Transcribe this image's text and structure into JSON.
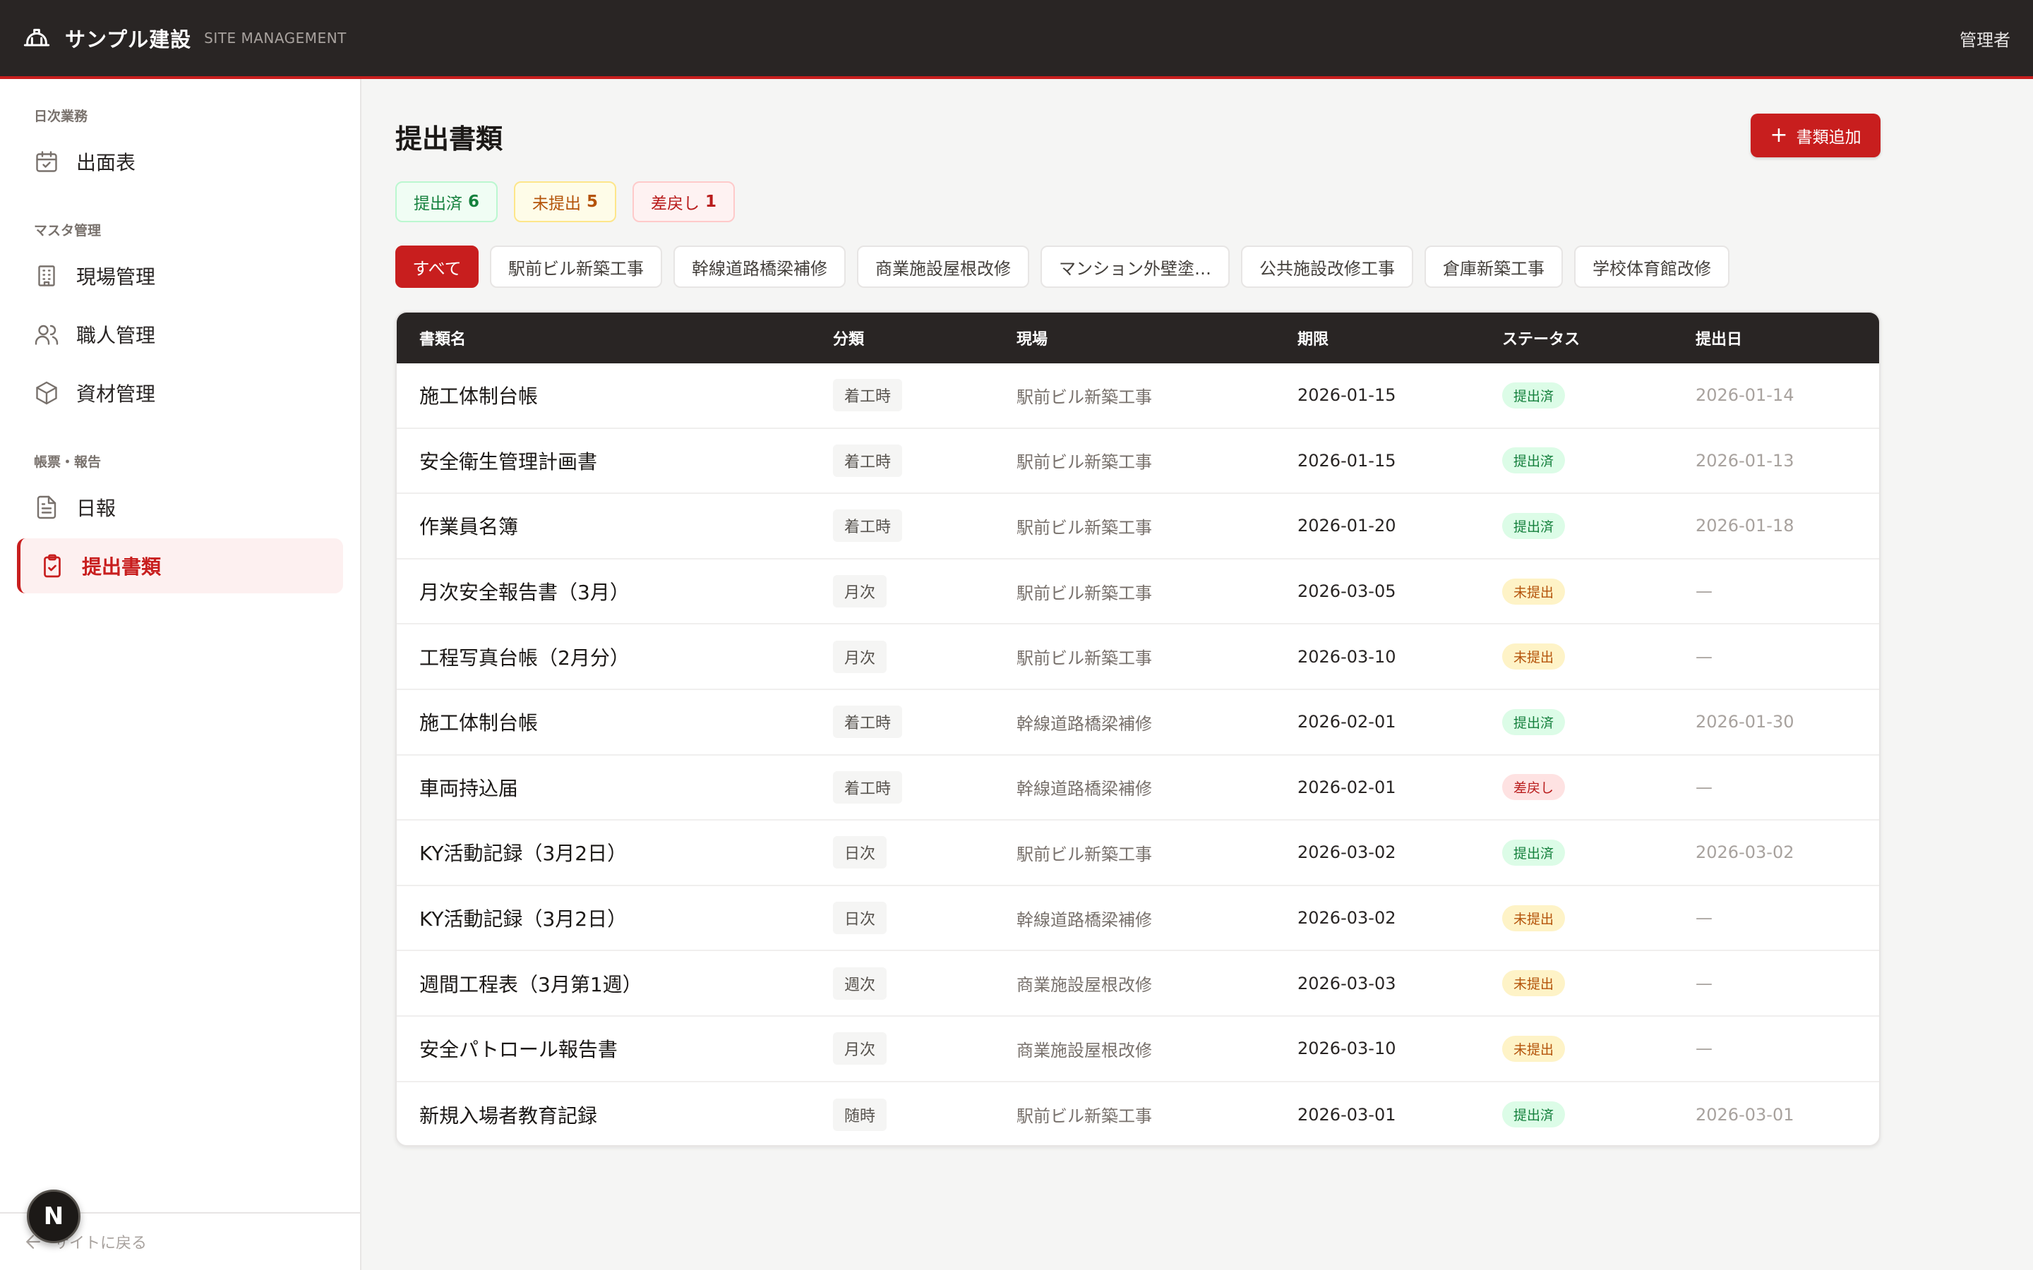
{
  "header": {
    "brand_name": "サンプル建設",
    "brand_sub": "SITE MANAGEMENT",
    "user_label": "管理者",
    "logo_icon": "hard-hat-icon"
  },
  "sidebar": {
    "sections": [
      {
        "label": "日次業務",
        "items": [
          {
            "label": "出面表",
            "icon": "calendar-check-icon"
          }
        ]
      },
      {
        "label": "マスタ管理",
        "items": [
          {
            "label": "現場管理",
            "icon": "building-icon"
          },
          {
            "label": "職人管理",
            "icon": "users-icon"
          },
          {
            "label": "資材管理",
            "icon": "box-icon"
          }
        ]
      },
      {
        "label": "帳票・報告",
        "items": [
          {
            "label": "日報",
            "icon": "document-icon"
          },
          {
            "label": "提出書類",
            "icon": "clipboard-check-icon",
            "active": true
          }
        ]
      }
    ],
    "footer_label": "サイトに戻る",
    "n_badge": "N"
  },
  "main": {
    "title": "提出書類",
    "add_button_label": "書類追加",
    "stats": [
      {
        "label": "提出済",
        "count": "6",
        "color": "#15803d"
      },
      {
        "label": "未提出",
        "count": "5",
        "color": "#b45309"
      },
      {
        "label": "差戻し",
        "count": "1",
        "color": "#b91c1c"
      }
    ],
    "filters": [
      "すべて",
      "駅前ビル新築工事",
      "幹線道路橋梁補修",
      "商業施設屋根改修",
      "マンション外壁塗…",
      "公共施設改修工事",
      "倉庫新築工事",
      "学校体育館改修"
    ],
    "active_filter": "すべて"
  },
  "table": {
    "columns": [
      "書類名",
      "分類",
      "現場",
      "期限",
      "ステータス",
      "提出日"
    ],
    "rows": [
      {
        "name": "施工体制台帳",
        "category": "着工時",
        "site": "駅前ビル新築工事",
        "due": "2026-01-15",
        "status": "提出済",
        "submitted": "2026-01-14"
      },
      {
        "name": "安全衛生管理計画書",
        "category": "着工時",
        "site": "駅前ビル新築工事",
        "due": "2026-01-15",
        "status": "提出済",
        "submitted": "2026-01-13"
      },
      {
        "name": "作業員名簿",
        "category": "着工時",
        "site": "駅前ビル新築工事",
        "due": "2026-01-20",
        "status": "提出済",
        "submitted": "2026-01-18"
      },
      {
        "name": "月次安全報告書（3月）",
        "category": "月次",
        "site": "駅前ビル新築工事",
        "due": "2026-03-05",
        "status": "未提出",
        "submitted": "—"
      },
      {
        "name": "工程写真台帳（2月分）",
        "category": "月次",
        "site": "駅前ビル新築工事",
        "due": "2026-03-10",
        "status": "未提出",
        "submitted": "—"
      },
      {
        "name": "施工体制台帳",
        "category": "着工時",
        "site": "幹線道路橋梁補修",
        "due": "2026-02-01",
        "status": "提出済",
        "submitted": "2026-01-30"
      },
      {
        "name": "車両持込届",
        "category": "着工時",
        "site": "幹線道路橋梁補修",
        "due": "2026-02-01",
        "status": "差戻し",
        "submitted": "—"
      },
      {
        "name": "KY活動記録（3月2日）",
        "category": "日次",
        "site": "駅前ビル新築工事",
        "due": "2026-03-02",
        "status": "提出済",
        "submitted": "2026-03-02"
      },
      {
        "name": "KY活動記録（3月2日）",
        "category": "日次",
        "site": "幹線道路橋梁補修",
        "due": "2026-03-02",
        "status": "未提出",
        "submitted": "—"
      },
      {
        "name": "週間工程表（3月第1週）",
        "category": "週次",
        "site": "商業施設屋根改修",
        "due": "2026-03-03",
        "status": "未提出",
        "submitted": "—"
      },
      {
        "name": "安全パトロール報告書",
        "category": "月次",
        "site": "商業施設屋根改修",
        "due": "2026-03-10",
        "status": "未提出",
        "submitted": "—"
      },
      {
        "name": "新規入場者教育記録",
        "category": "随時",
        "site": "駅前ビル新築工事",
        "due": "2026-03-01",
        "status": "提出済",
        "submitted": "2026-03-01"
      }
    ]
  },
  "colors": {
    "accent": "#c81e1e",
    "header_bg": "#292524",
    "status_done": "#15803d",
    "status_pending": "#b45309",
    "status_rejected": "#b91c1c"
  }
}
